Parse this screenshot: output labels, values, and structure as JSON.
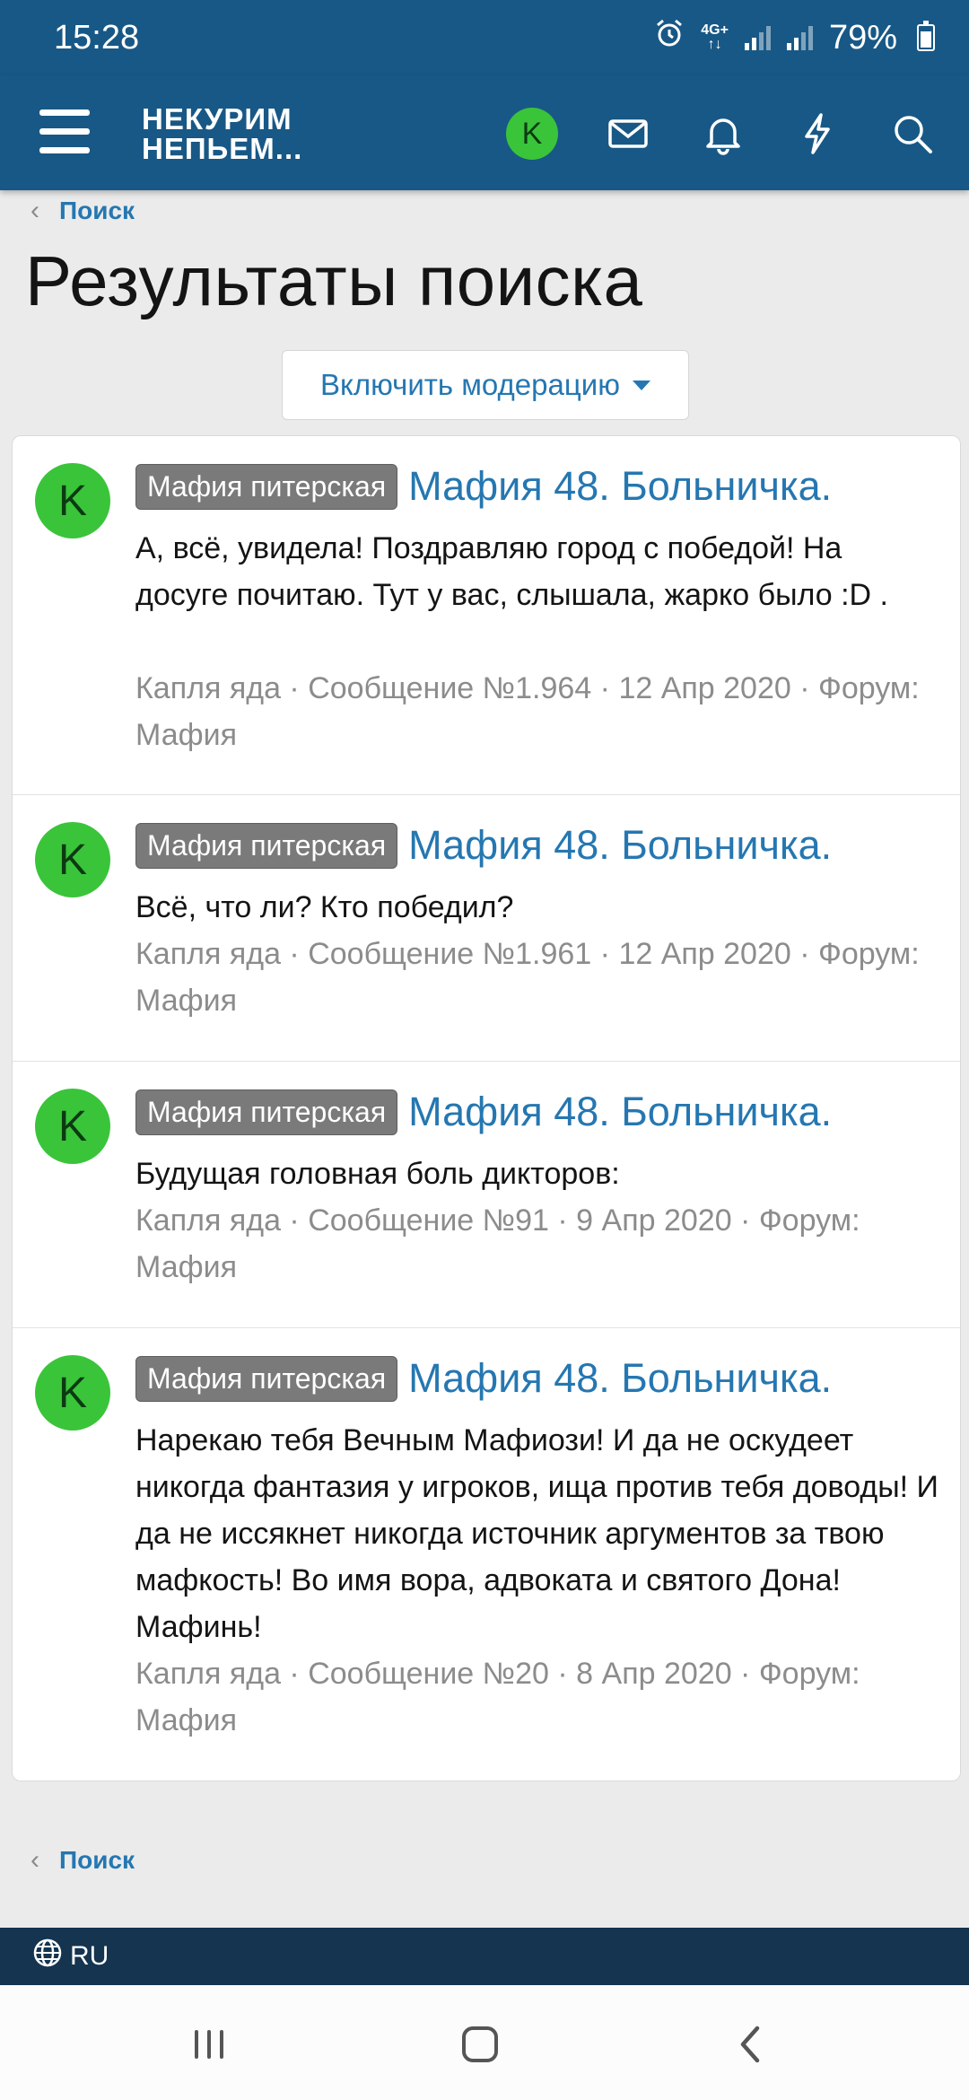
{
  "status_bar": {
    "time": "15:28",
    "network_top": "4G+",
    "network_bottom": "↑↓",
    "battery": "79%",
    "icons": [
      "alarm-icon",
      "signal-icon",
      "battery-icon"
    ]
  },
  "header": {
    "logo_line1": "НЕКУРИМ",
    "logo_line2": "НЕПЬЕМ...",
    "avatar_letter": "K",
    "icons": [
      "menu-icon",
      "mail-icon",
      "bell-icon",
      "lightning-icon",
      "search-icon"
    ]
  },
  "breadcrumb_top": {
    "label": "Поиск"
  },
  "page_title": "Результаты поиска",
  "moderation_button": {
    "label": "Включить модерацию"
  },
  "results": [
    {
      "avatar_letter": "K",
      "tag": "Мафия питерская",
      "title": "Мафия 48. Больничка.",
      "body": "А, всё, увидела! Поздравляю город с победой! На досуге почитаю. Тут у вас, слышала, жарко было :D .",
      "meta": "Капля яда · Сообщение №1.964 · 12 Апр 2020 · Форум: Мафия"
    },
    {
      "avatar_letter": "K",
      "tag": "Мафия питерская",
      "title": "Мафия 48. Больничка.",
      "body": "Всё, что ли? Кто победил?",
      "meta": "Капля яда · Сообщение №1.961 · 12 Апр 2020 · Форум: Мафия"
    },
    {
      "avatar_letter": "K",
      "tag": "Мафия питерская",
      "title": "Мафия 48. Больничка.",
      "body": "Будущая головная боль дикторов:",
      "meta": "Капля яда · Сообщение №91 · 9 Апр 2020 · Форум: Мафия"
    },
    {
      "avatar_letter": "K",
      "tag": "Мафия питерская",
      "title": "Мафия 48. Больничка.",
      "body": "Нарекаю тебя Вечным Мафиози! И да не оскудеет никогда фантазия у игроков, ища против тебя доводы! И да не иссякнет никогда источник аргументов за твою мафкость! Во имя вора, адвоката и святого Дона! Мафинь!",
      "meta": "Капля яда · Сообщение №20 · 8 Апр 2020 · Форум: Мафия"
    }
  ],
  "breadcrumb_bottom": {
    "label": "Поиск"
  },
  "footer": {
    "language": "RU",
    "icon": "globe-icon"
  },
  "system_nav": {
    "icons": [
      "recents-icon",
      "home-icon",
      "back-icon"
    ]
  },
  "colors": {
    "header_bg": "#185886",
    "link": "#2577b1",
    "avatar_bg": "#3ac43a",
    "tag_bg": "#7a7a7a",
    "footer_bg": "#14344f"
  }
}
